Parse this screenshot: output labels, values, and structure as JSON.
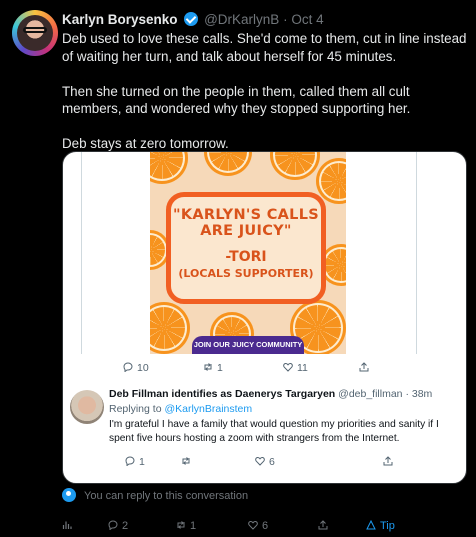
{
  "author": {
    "name": "Karlyn Borysenko",
    "handle": "@DrKarlynB",
    "separator": "·",
    "time": "Oct 4"
  },
  "tweet": {
    "text": "Deb used to love these calls. She'd come to them, cut in line instead of waiting her turn, and talk about herself for 45 minutes.\n\nThen she turned on the people in them, called them all cult members, and wondered why they stopped supporting her.\n\nDeb stays at zero tomorrow."
  },
  "quote": {
    "promo": {
      "quote_line": "\"KARLYN'S CALLS ARE JUICY\"",
      "attribution": "-TORI",
      "role": "(LOCALS SUPPORTER)",
      "cta": "JOIN OUR JUICY COMMUNITY"
    },
    "media_actions": {
      "replies": "10",
      "retweets": "1",
      "likes": "11"
    },
    "reply": {
      "name": "Deb Fillman identifies as Daenerys Targaryen",
      "handle": "@deb_fillman",
      "separator": "·",
      "time": "38m",
      "replying_to_label": "Replying to",
      "replying_to_handle": "@KarlynBrainstem",
      "text": "I'm grateful I have a family that would question my priorities and sanity if I spent five hours hosting a zoom with strangers from the Internet.",
      "actions": {
        "replies": "1",
        "retweets": "",
        "likes": "6"
      }
    }
  },
  "conversation_note": "You can reply to this conversation",
  "bottom_actions": {
    "replies": "2",
    "retweets": "1",
    "likes": "6",
    "tip": "Tip"
  },
  "colors": {
    "background": "#000000",
    "accent": "#1d9bf0",
    "orange": "#f7931e",
    "promo_border": "#f15f22",
    "cta": "#4b2a8f"
  }
}
